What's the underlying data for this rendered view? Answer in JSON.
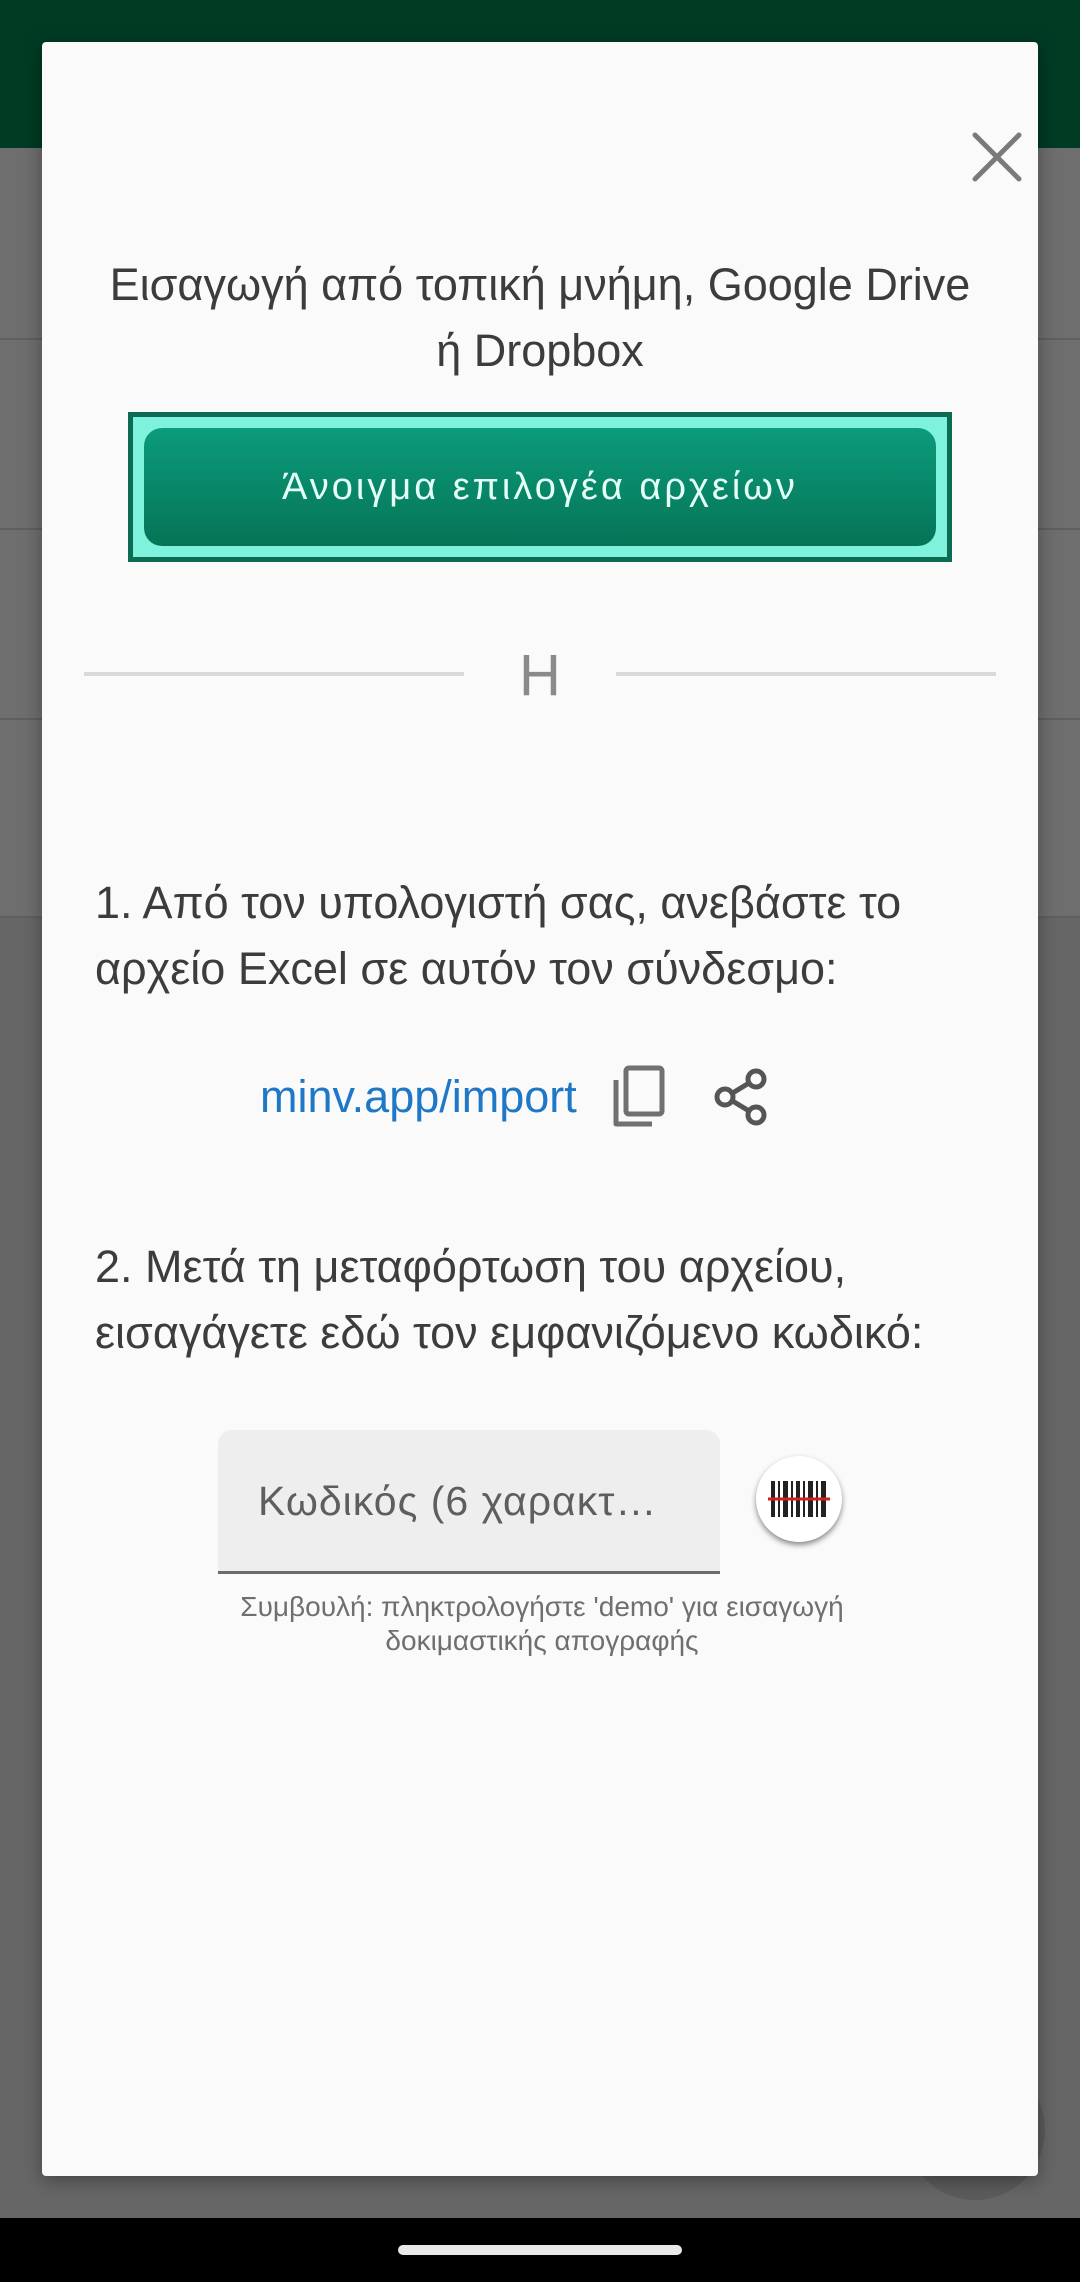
{
  "colors": {
    "accent": "#087a5c",
    "button_highlight": "#7ff2dd",
    "link": "#1e78c7",
    "status_bar": "#003b24"
  },
  "dialog": {
    "close_icon": "close-icon",
    "intro_text": "Εισαγωγή από τοπική μνήμη, Google Drive ή Dropbox",
    "open_file_picker_label": "Άνοιγμα επιλογέα αρχείων",
    "divider_text": "Η",
    "step1_text": "1. Από τον υπολογιστή σας, ανεβάστε το αρχείο Excel σε αυτόν τον σύνδεσμο:",
    "import_link": "minv.app/import",
    "copy_icon": "copy-icon",
    "share_icon": "share-icon",
    "step2_text": "2. Μετά τη μεταφόρτωση του αρχείου, εισαγάγετε εδώ τον εμφανιζόμενο κωδικό:",
    "code_input": {
      "placeholder": "Κωδικός (6 χαρακτ…",
      "value": ""
    },
    "barcode_icon": "barcode-scanner-icon",
    "hint_text": "Συμβουλή: πληκτρολογήστε 'demo' για εισαγωγή δοκιμαστικής απογραφής"
  }
}
